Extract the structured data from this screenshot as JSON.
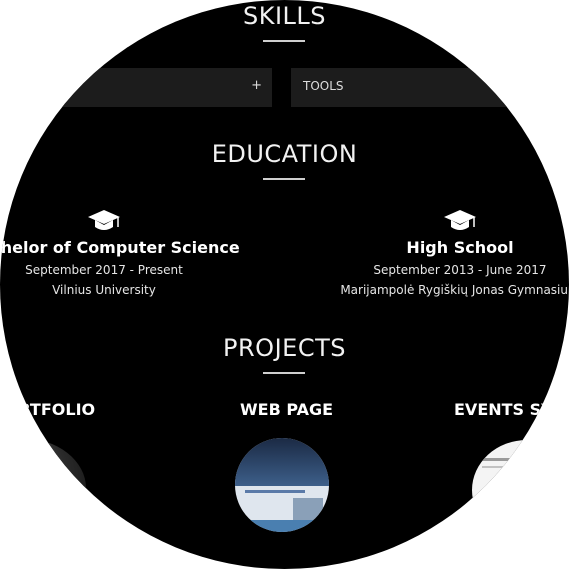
{
  "skills": {
    "title": "SKILLS",
    "accordions": [
      {
        "label": "",
        "toggle": "+"
      },
      {
        "label": "TOOLS",
        "toggle": ""
      }
    ]
  },
  "education": {
    "title": "EDUCATION",
    "items": [
      {
        "degree": "Bachelor of Computer Science",
        "dates": "September 2017 - Present",
        "school": "Vilnius University",
        "icon": "graduation-cap-icon"
      },
      {
        "degree": "High School",
        "dates": "September 2013 - June 2017",
        "school": "Marijampolė Rygiškių Jonas Gymnasium",
        "icon": "graduation-cap-icon"
      }
    ]
  },
  "projects": {
    "title": "PROJECTS",
    "items": [
      {
        "name": "PORTFOLIO"
      },
      {
        "name": "WEB PAGE"
      },
      {
        "name": "EVENTS SYSTEM"
      }
    ]
  },
  "colors": {
    "background": "#000000",
    "accent_rule": "#cfcfcf",
    "accordion_bg": "#1c1c1c"
  }
}
